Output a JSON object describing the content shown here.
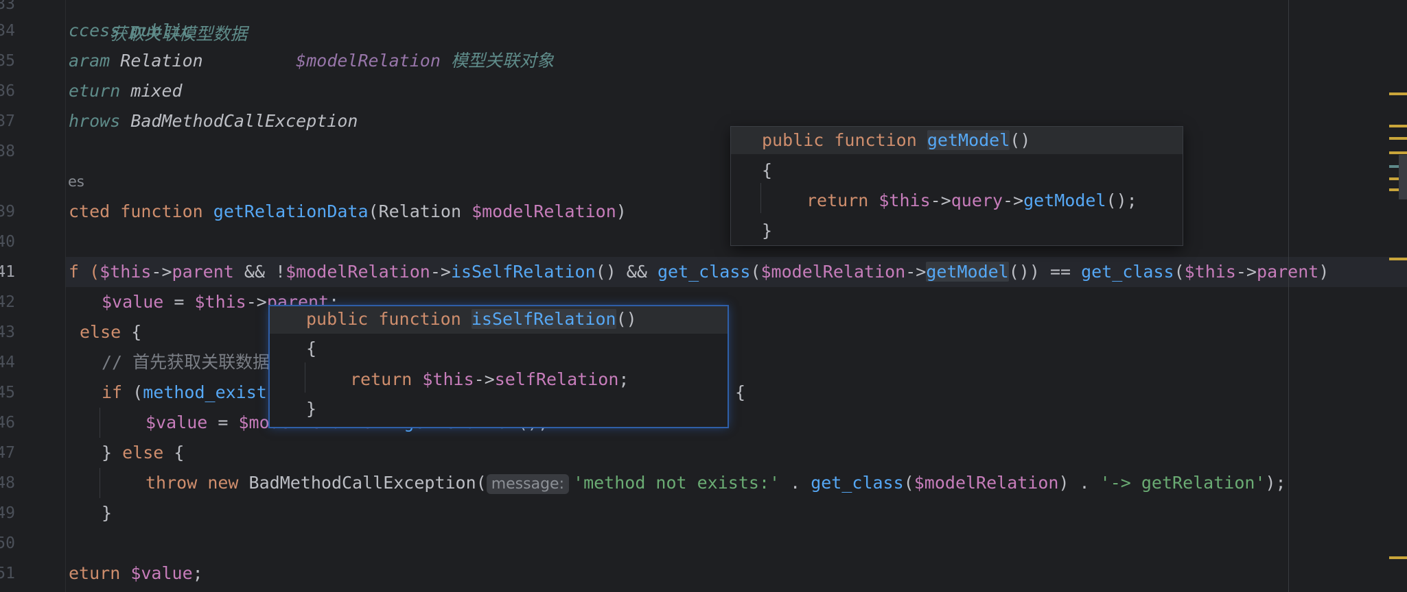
{
  "line_numbers": [
    "33",
    "34",
    "35",
    "36",
    "37",
    "38",
    "39",
    "40",
    "41",
    "42",
    "43",
    "44",
    "45",
    "46",
    "47",
    "48",
    "49",
    "50",
    "51"
  ],
  "code": {
    "l33_comment": "获取关联模型数据",
    "l34_tag": "ccess",
    "l34_val": "public",
    "l35_tag": "aram",
    "l35_type": "Relation",
    "l35_var": "$modelRelation",
    "l35_desc": "模型关联对象",
    "l36_tag": "eturn",
    "l36_val": "mixed",
    "l37_tag": "hrows",
    "l37_val": "BadMethodCallException",
    "usages_hint": "es",
    "l39_kw1": "cted",
    "l39_kw2": "function",
    "l39_fn": "getRelationData",
    "l39_p1": "(Relation ",
    "l39_var": "$modelRelation",
    "l39_p2": ")",
    "l41_a": "f (",
    "l41_this": "$this",
    "l41_arrow1": "->",
    "l41_parent": "parent",
    "l41_and1": " && !",
    "l41_mr": "$modelRelation",
    "l41_arrow2": "->",
    "l41_isself": "isSelfRelation",
    "l41_p1": "() && ",
    "l41_getclass1": "get_class",
    "l41_p2": "(",
    "l41_mr2": "$modelRelation",
    "l41_arrow3": "->",
    "l41_getmodel": "getModel",
    "l41_p3": "()) == ",
    "l41_getclass2": "get_class",
    "l41_p4": "(",
    "l41_this2": "$this",
    "l41_arrow4": "->",
    "l41_parent2": "parent",
    "l41_p5": ")",
    "l42_value": "$value",
    "l42_eq": " = ",
    "l42_this": "$this",
    "l42_arrow": "->",
    "l42_parent": "parent",
    "l42_end": ";",
    "l43_else": "else",
    "l43_brace": " {",
    "l44_comment": "// 首先获取关联数据",
    "l45_if": "if",
    "l45_p": " (",
    "l45_fn": "method_exists",
    "l45_brace": "{",
    "l46_value": "$value",
    "l46_eq": " = ",
    "l46_mr": "$modelRelation",
    "l46_arrow": "->",
    "l46_fn": "getRelation",
    "l46_end": "();",
    "l47_close": "} ",
    "l47_else": "else",
    "l47_brace": " {",
    "l48_throw": "throw",
    "l48_new": "new",
    "l48_class": " BadMethodCallException(",
    "l48_inlay": "message:",
    "l48_str1": "'method not exists:'",
    "l48_dot1": " . ",
    "l48_getclass": "get_class",
    "l48_p1": "(",
    "l48_mr": "$modelRelation",
    "l48_p2": ") . ",
    "l48_str2": "'-> getRelation'",
    "l48_end": ");",
    "l49_close": "}",
    "l51_ret": "eturn",
    "l51_value": "$value",
    "l51_end": ";"
  },
  "popup_getmodel": {
    "kw1": "public",
    "kw2": "function",
    "name": "getModel",
    "parens": "()",
    "open": "{",
    "ret": "return",
    "this": "$this",
    "arrow1": "->",
    "prop": "query",
    "arrow2": "->",
    "call": "getModel",
    "end": "();",
    "close": "}"
  },
  "popup_isself": {
    "kw1": "public",
    "kw2": "function",
    "name": "isSelfRelation",
    "parens": "()",
    "open": "{",
    "ret": "return",
    "this": "$this",
    "arrow": "->",
    "prop": "selfRelation",
    "end": ";",
    "close": "}"
  }
}
